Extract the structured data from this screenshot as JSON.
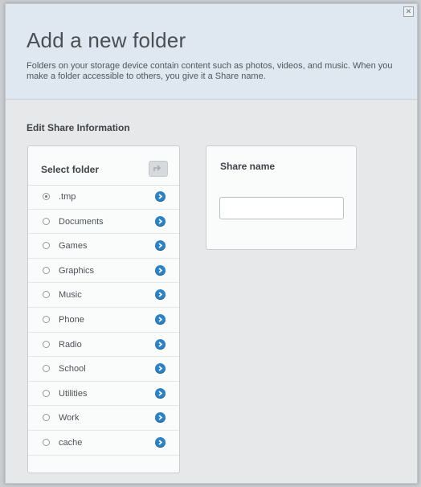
{
  "dialog": {
    "title": "Add a new folder",
    "description": "Folders on your storage device contain content such as photos, videos, and music. When you make a folder accessible to others, you give it a Share name.",
    "close_icon": "close-icon",
    "close_glyph": "✕"
  },
  "edit_share": {
    "section_title": "Edit Share Information",
    "select_folder": {
      "title": "Select folder",
      "up_icon": "folder-up-icon",
      "selected_index": 0,
      "folders": [
        {
          "name": ".tmp"
        },
        {
          "name": "Documents"
        },
        {
          "name": "Games"
        },
        {
          "name": "Graphics"
        },
        {
          "name": "Music"
        },
        {
          "name": "Phone"
        },
        {
          "name": "Radio"
        },
        {
          "name": "School"
        },
        {
          "name": "Utilities"
        },
        {
          "name": "Work"
        },
        {
          "name": "cache"
        }
      ],
      "row_icon": "chevron-right-icon"
    },
    "share_name": {
      "title": "Share name",
      "value": "",
      "placeholder": ""
    }
  },
  "colors": {
    "accent": "#2d82c4",
    "header_bg": "#dfe8f0",
    "dialog_bg": "#e6e8ea"
  }
}
